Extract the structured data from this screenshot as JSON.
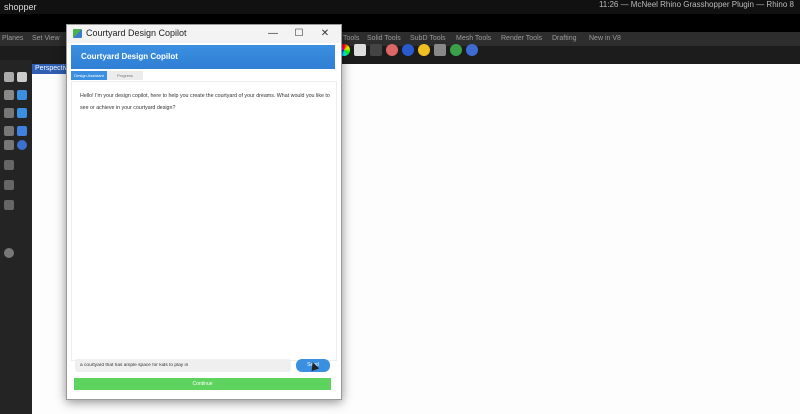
{
  "host_app": {
    "title": "shopper",
    "top_right_text": "11:26 — McNeel Rhino Grasshopper Plugin — Rhino 8",
    "tabs": [
      "Planes",
      "Set View",
      "Tools",
      "Solid Tools",
      "SubD Tools",
      "Mesh Tools",
      "Render Tools",
      "Drafting",
      "New in V8"
    ],
    "viewport_label": "Perspective"
  },
  "dialog": {
    "title": "Courtyard Design Copilot",
    "header": "Courtyard Design Copilot",
    "tabs": {
      "active": "Design Assistant",
      "inactive": "Progress"
    },
    "message": "Hello! I'm your design copilot, here to help you create the courtyard of your dreams. What would you like to see or achieve in your courtyard design?",
    "input_value": "a courtyard that has ample space for kids to play in",
    "send_label": "Send",
    "continue_label": "Continue",
    "window_controls": {
      "minimize": "—",
      "maximize": "☐",
      "close": "✕"
    }
  },
  "colors": {
    "accent": "#3b8fe0",
    "continue": "#5fd35f",
    "host_background": "#1c1c1c"
  }
}
